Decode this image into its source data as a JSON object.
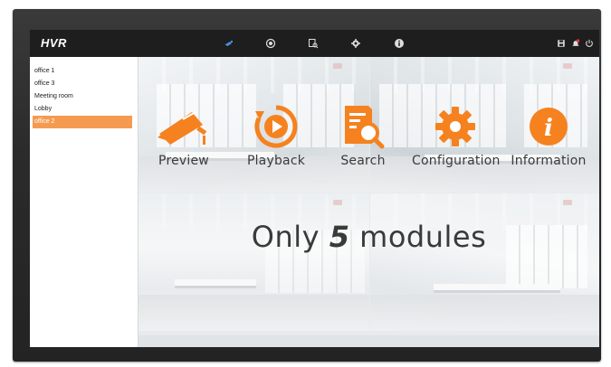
{
  "app": {
    "brand": "HVR"
  },
  "topnav": {
    "items": [
      {
        "name": "preview-nav",
        "icon": "camera-icon",
        "active": true
      },
      {
        "name": "playback-nav",
        "icon": "playback-icon"
      },
      {
        "name": "search-nav",
        "icon": "search-icon"
      },
      {
        "name": "configuration-nav",
        "icon": "gear-icon"
      },
      {
        "name": "information-nav",
        "icon": "info-icon"
      }
    ],
    "right": [
      {
        "name": "save-nav",
        "icon": "floppy-icon"
      },
      {
        "name": "alarm-nav",
        "icon": "bell-icon"
      },
      {
        "name": "power-nav",
        "icon": "power-icon"
      }
    ]
  },
  "sidebar": {
    "items": [
      {
        "label": "office 1"
      },
      {
        "label": "office 3"
      },
      {
        "label": "Meeting room"
      },
      {
        "label": "Lobby"
      },
      {
        "label": "office 2",
        "selected": true
      }
    ]
  },
  "modules": [
    {
      "label": "Preview",
      "icon": "camera-icon"
    },
    {
      "label": "Playback",
      "icon": "playback-icon"
    },
    {
      "label": "Search",
      "icon": "search-document-icon"
    },
    {
      "label": "Configuration",
      "icon": "gear-icon"
    },
    {
      "label": "Information",
      "icon": "info-icon"
    }
  ],
  "tagline": {
    "prefix": "Only ",
    "number": "5",
    "suffix": " modules"
  },
  "colors": {
    "accent": "#f5821f",
    "selected": "#f59b51",
    "topbar": "#1e1e1e",
    "bezel": "#2b2b2b"
  }
}
